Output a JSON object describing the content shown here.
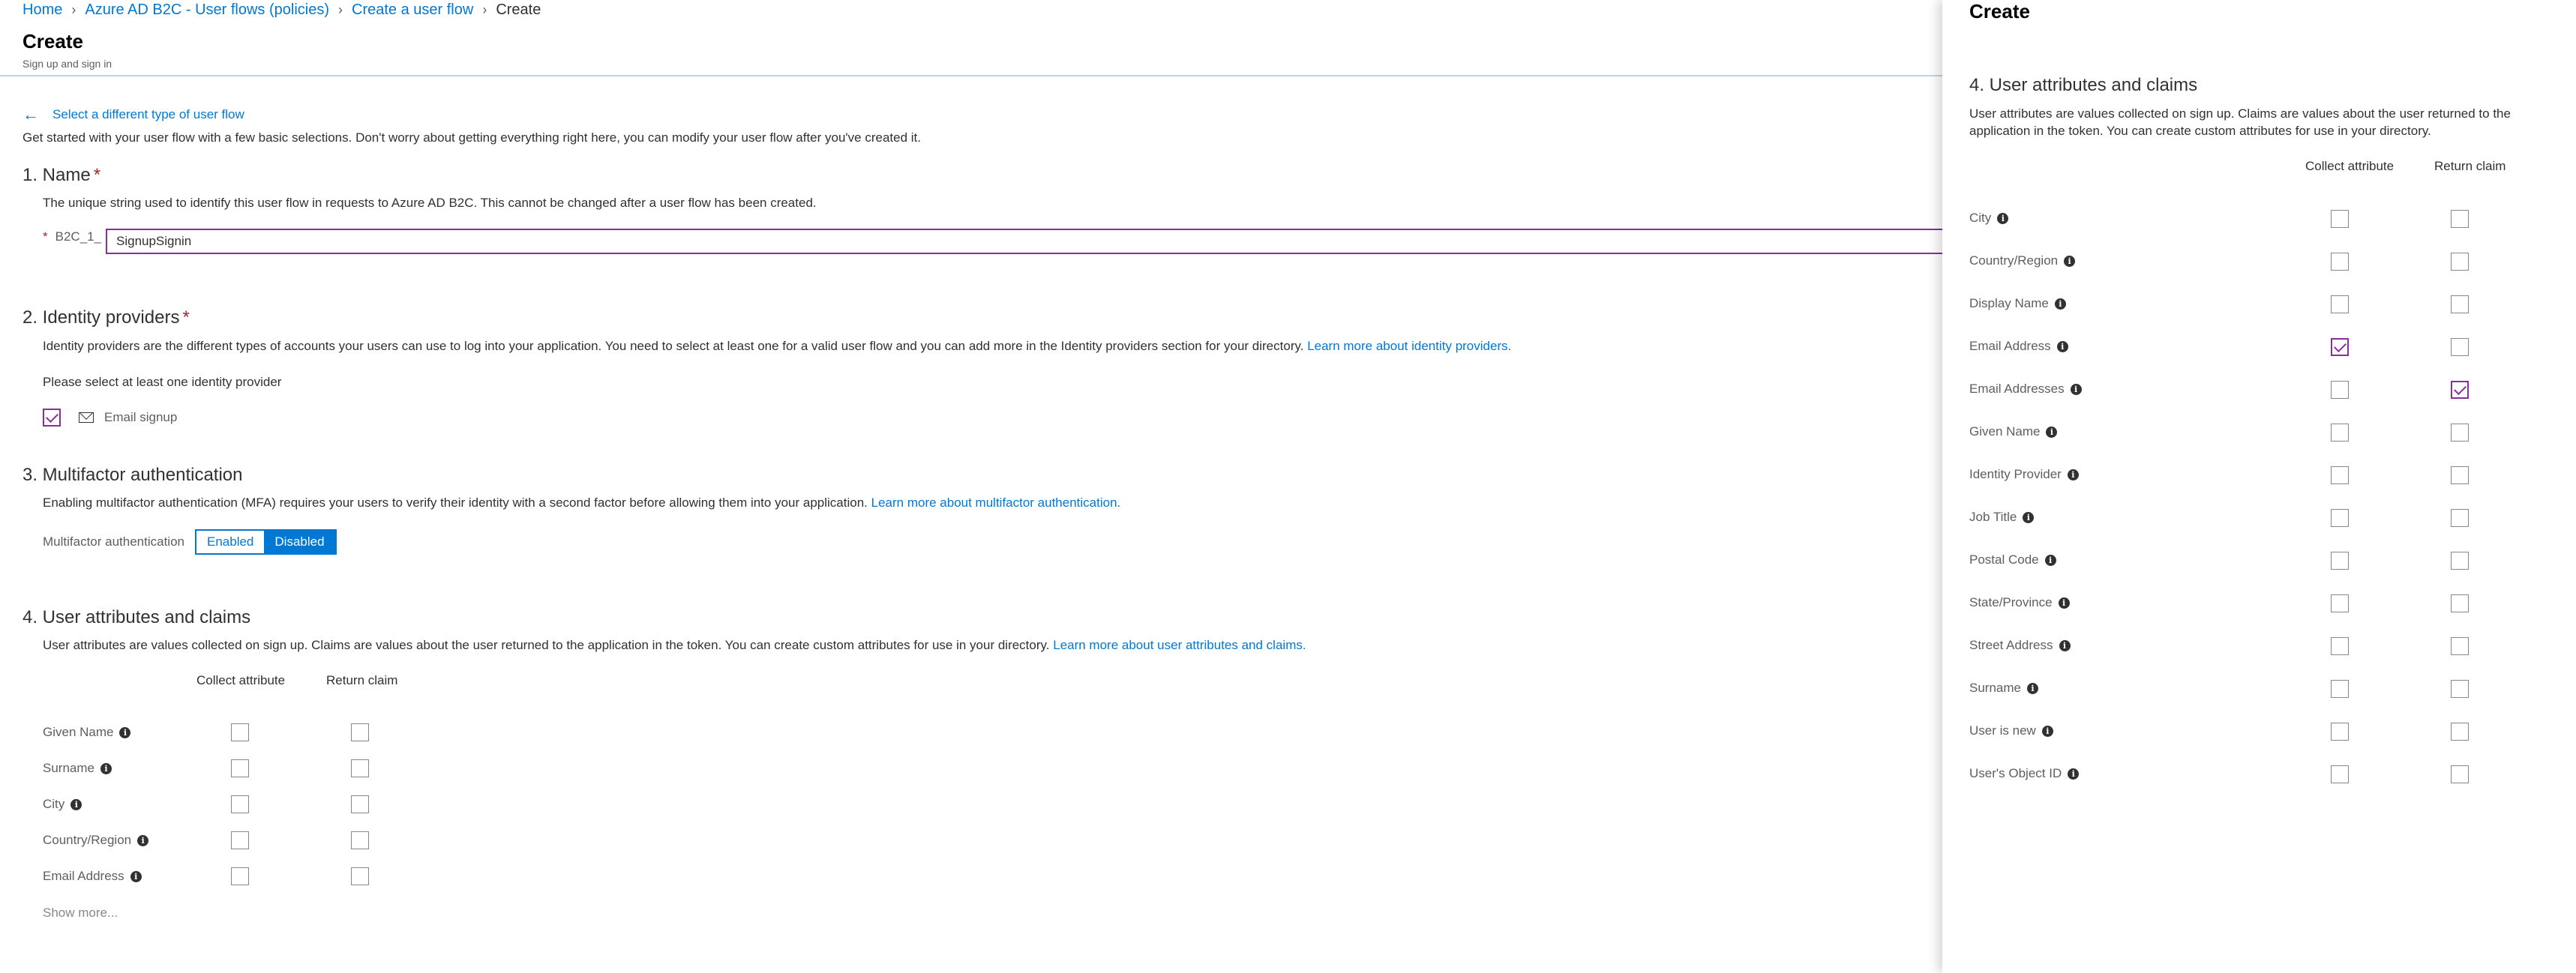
{
  "breadcrumb": {
    "items": [
      "Home",
      "Azure AD B2C - User flows (policies)",
      "Create a user flow"
    ],
    "current": "Create"
  },
  "header": {
    "title": "Create",
    "subtitle": "Sign up and sign in"
  },
  "back_link": "Select a different type of user flow",
  "intro": "Get started with your user flow with a few basic selections. Don't worry about getting everything right here, you can modify your user flow after you've created it.",
  "section1": {
    "title": "1. Name",
    "required": "*",
    "description": "The unique string used to identify this user flow in requests to Azure AD B2C. This cannot be changed after a user flow has been created.",
    "prefix": "B2C_1_",
    "value": "SignupSignin"
  },
  "section2": {
    "title": "2. Identity providers",
    "required": "*",
    "description": "Identity providers are the different types of accounts your users can use to log into your application. You need to select at least one for a valid user flow and you can add more in the Identity providers section for your directory.",
    "link": "Learn more about identity providers.",
    "hint": "Please select at least one identity provider",
    "provider": "Email signup"
  },
  "section3": {
    "title": "3. Multifactor authentication",
    "description": "Enabling multifactor authentication (MFA) requires your users to verify their identity with a second factor before allowing them into your application.",
    "link": "Learn more about multifactor authentication.",
    "label": "Multifactor authentication",
    "enabled": "Enabled",
    "disabled": "Disabled",
    "selected": "Disabled"
  },
  "section4": {
    "title": "4. User attributes and claims",
    "description": "User attributes are values collected on sign up. Claims are values about the user returned to the application in the token. You can create custom attributes for use in your directory.",
    "link": "Learn more about user attributes and claims.",
    "col_collect": "Collect attribute",
    "col_return": "Return claim",
    "rows": [
      {
        "label": "Given Name",
        "collect": false,
        "return": false
      },
      {
        "label": "Surname",
        "collect": false,
        "return": false
      },
      {
        "label": "City",
        "collect": false,
        "return": false
      },
      {
        "label": "Country/Region",
        "collect": false,
        "return": false
      },
      {
        "label": "Email Address",
        "collect": false,
        "return": false
      }
    ],
    "show_more": "Show more..."
  },
  "panel": {
    "title": "Create",
    "section_title": "4. User attributes and claims",
    "description": "User attributes are values collected on sign up. Claims are values about the user returned to the application in the token. You can create custom attributes for use in your directory.",
    "col_collect": "Collect attribute",
    "col_return": "Return claim",
    "rows": [
      {
        "label": "City",
        "collect": false,
        "return": false
      },
      {
        "label": "Country/Region",
        "collect": false,
        "return": false
      },
      {
        "label": "Display Name",
        "collect": false,
        "return": false
      },
      {
        "label": "Email Address",
        "collect": true,
        "return": false
      },
      {
        "label": "Email Addresses",
        "collect": false,
        "return": true
      },
      {
        "label": "Given Name",
        "collect": false,
        "return": false
      },
      {
        "label": "Identity Provider",
        "collect": false,
        "return": false
      },
      {
        "label": "Job Title",
        "collect": false,
        "return": false
      },
      {
        "label": "Postal Code",
        "collect": false,
        "return": false
      },
      {
        "label": "State/Province",
        "collect": false,
        "return": false
      },
      {
        "label": "Street Address",
        "collect": false,
        "return": false
      },
      {
        "label": "Surname",
        "collect": false,
        "return": false
      },
      {
        "label": "User is new",
        "collect": false,
        "return": false
      },
      {
        "label": "User's Object ID",
        "collect": false,
        "return": false
      }
    ]
  },
  "colors": {
    "accent": "#0078d4",
    "checked": "#8a2e9e",
    "required": "#a4262c"
  }
}
